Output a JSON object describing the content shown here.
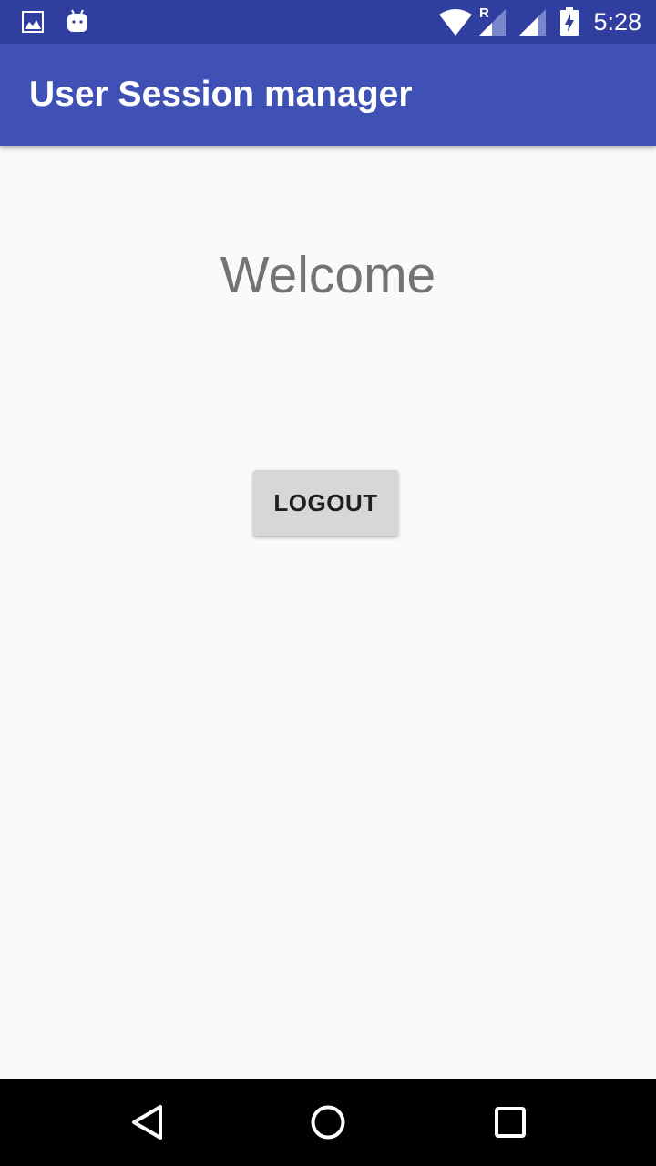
{
  "status_bar": {
    "time": "5:28",
    "icons": [
      "image-icon",
      "android-icon",
      "wifi-icon",
      "signal-roaming-icon",
      "signal-icon",
      "battery-charging-icon"
    ],
    "roaming_label": "R"
  },
  "app_bar": {
    "title": "User Session manager",
    "color": "#3f51b5"
  },
  "main": {
    "welcome_text": "Welcome",
    "logout_label": "LOGOUT"
  },
  "nav_bar": {
    "icons": [
      "back-icon",
      "home-icon",
      "recents-icon"
    ]
  },
  "colors": {
    "status_bar": "#303f9f",
    "primary": "#3f51b5",
    "background": "#fafafa",
    "button": "#d6d7d7"
  }
}
